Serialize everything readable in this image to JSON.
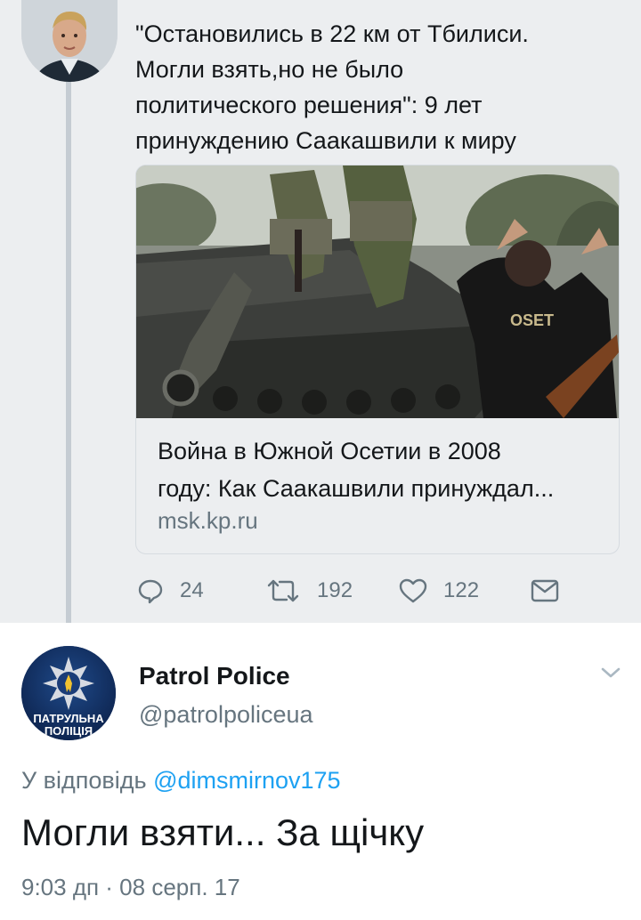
{
  "parent_tweet": {
    "text_lines": [
      "\"Остановились в 22 км от Тбилиси.",
      "Могли взять,но не было",
      "политического решения\": 9 лет",
      "принуждению Саакашвили к миру"
    ],
    "card": {
      "title_lines": [
        "Война в Южной Осетии в 2008",
        "году: Как Саакашвили принуждал..."
      ],
      "domain": "msk.kp.ru",
      "shirt_text": "OSET"
    },
    "actions": {
      "replies": "24",
      "retweets": "192",
      "likes": "122"
    }
  },
  "reply_tweet": {
    "author_name": "Patrol Police",
    "author_handle": "@patrolpoliceua",
    "avatar_text_lines": [
      "ПАТРУЛЬНА",
      "ПОЛІЦІЯ"
    ],
    "reply_prefix": "У відповідь",
    "reply_mention": "@dimsmirnov175",
    "text": "Могли взяти... За щічку",
    "timestamp": "9:03 дп · 08 серп. 17"
  },
  "colors": {
    "background_parent": "#eceef0",
    "thread_line": "#c5ccd3",
    "text_primary": "#14171a",
    "text_secondary": "#66757f",
    "link": "#1da1f2"
  },
  "icons": [
    "reply-icon",
    "retweet-icon",
    "like-icon",
    "direct-message-icon",
    "chevron-down-icon",
    "police-star-icon"
  ]
}
